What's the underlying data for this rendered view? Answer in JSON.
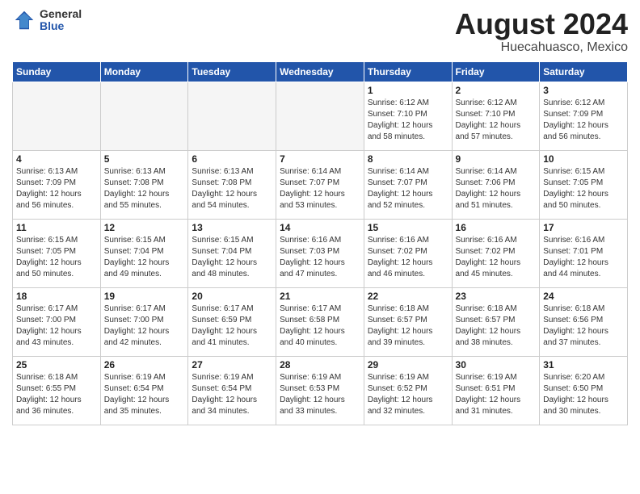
{
  "logo": {
    "general": "General",
    "blue": "Blue"
  },
  "title": {
    "month_year": "August 2024",
    "location": "Huecahuasco, Mexico"
  },
  "days_of_week": [
    "Sunday",
    "Monday",
    "Tuesday",
    "Wednesday",
    "Thursday",
    "Friday",
    "Saturday"
  ],
  "weeks": [
    [
      {
        "day": "",
        "info": ""
      },
      {
        "day": "",
        "info": ""
      },
      {
        "day": "",
        "info": ""
      },
      {
        "day": "",
        "info": ""
      },
      {
        "day": "1",
        "info": "Sunrise: 6:12 AM\nSunset: 7:10 PM\nDaylight: 12 hours\nand 58 minutes."
      },
      {
        "day": "2",
        "info": "Sunrise: 6:12 AM\nSunset: 7:10 PM\nDaylight: 12 hours\nand 57 minutes."
      },
      {
        "day": "3",
        "info": "Sunrise: 6:12 AM\nSunset: 7:09 PM\nDaylight: 12 hours\nand 56 minutes."
      }
    ],
    [
      {
        "day": "4",
        "info": "Sunrise: 6:13 AM\nSunset: 7:09 PM\nDaylight: 12 hours\nand 56 minutes."
      },
      {
        "day": "5",
        "info": "Sunrise: 6:13 AM\nSunset: 7:08 PM\nDaylight: 12 hours\nand 55 minutes."
      },
      {
        "day": "6",
        "info": "Sunrise: 6:13 AM\nSunset: 7:08 PM\nDaylight: 12 hours\nand 54 minutes."
      },
      {
        "day": "7",
        "info": "Sunrise: 6:14 AM\nSunset: 7:07 PM\nDaylight: 12 hours\nand 53 minutes."
      },
      {
        "day": "8",
        "info": "Sunrise: 6:14 AM\nSunset: 7:07 PM\nDaylight: 12 hours\nand 52 minutes."
      },
      {
        "day": "9",
        "info": "Sunrise: 6:14 AM\nSunset: 7:06 PM\nDaylight: 12 hours\nand 51 minutes."
      },
      {
        "day": "10",
        "info": "Sunrise: 6:15 AM\nSunset: 7:05 PM\nDaylight: 12 hours\nand 50 minutes."
      }
    ],
    [
      {
        "day": "11",
        "info": "Sunrise: 6:15 AM\nSunset: 7:05 PM\nDaylight: 12 hours\nand 50 minutes."
      },
      {
        "day": "12",
        "info": "Sunrise: 6:15 AM\nSunset: 7:04 PM\nDaylight: 12 hours\nand 49 minutes."
      },
      {
        "day": "13",
        "info": "Sunrise: 6:15 AM\nSunset: 7:04 PM\nDaylight: 12 hours\nand 48 minutes."
      },
      {
        "day": "14",
        "info": "Sunrise: 6:16 AM\nSunset: 7:03 PM\nDaylight: 12 hours\nand 47 minutes."
      },
      {
        "day": "15",
        "info": "Sunrise: 6:16 AM\nSunset: 7:02 PM\nDaylight: 12 hours\nand 46 minutes."
      },
      {
        "day": "16",
        "info": "Sunrise: 6:16 AM\nSunset: 7:02 PM\nDaylight: 12 hours\nand 45 minutes."
      },
      {
        "day": "17",
        "info": "Sunrise: 6:16 AM\nSunset: 7:01 PM\nDaylight: 12 hours\nand 44 minutes."
      }
    ],
    [
      {
        "day": "18",
        "info": "Sunrise: 6:17 AM\nSunset: 7:00 PM\nDaylight: 12 hours\nand 43 minutes."
      },
      {
        "day": "19",
        "info": "Sunrise: 6:17 AM\nSunset: 7:00 PM\nDaylight: 12 hours\nand 42 minutes."
      },
      {
        "day": "20",
        "info": "Sunrise: 6:17 AM\nSunset: 6:59 PM\nDaylight: 12 hours\nand 41 minutes."
      },
      {
        "day": "21",
        "info": "Sunrise: 6:17 AM\nSunset: 6:58 PM\nDaylight: 12 hours\nand 40 minutes."
      },
      {
        "day": "22",
        "info": "Sunrise: 6:18 AM\nSunset: 6:57 PM\nDaylight: 12 hours\nand 39 minutes."
      },
      {
        "day": "23",
        "info": "Sunrise: 6:18 AM\nSunset: 6:57 PM\nDaylight: 12 hours\nand 38 minutes."
      },
      {
        "day": "24",
        "info": "Sunrise: 6:18 AM\nSunset: 6:56 PM\nDaylight: 12 hours\nand 37 minutes."
      }
    ],
    [
      {
        "day": "25",
        "info": "Sunrise: 6:18 AM\nSunset: 6:55 PM\nDaylight: 12 hours\nand 36 minutes."
      },
      {
        "day": "26",
        "info": "Sunrise: 6:19 AM\nSunset: 6:54 PM\nDaylight: 12 hours\nand 35 minutes."
      },
      {
        "day": "27",
        "info": "Sunrise: 6:19 AM\nSunset: 6:54 PM\nDaylight: 12 hours\nand 34 minutes."
      },
      {
        "day": "28",
        "info": "Sunrise: 6:19 AM\nSunset: 6:53 PM\nDaylight: 12 hours\nand 33 minutes."
      },
      {
        "day": "29",
        "info": "Sunrise: 6:19 AM\nSunset: 6:52 PM\nDaylight: 12 hours\nand 32 minutes."
      },
      {
        "day": "30",
        "info": "Sunrise: 6:19 AM\nSunset: 6:51 PM\nDaylight: 12 hours\nand 31 minutes."
      },
      {
        "day": "31",
        "info": "Sunrise: 6:20 AM\nSunset: 6:50 PM\nDaylight: 12 hours\nand 30 minutes."
      }
    ]
  ]
}
